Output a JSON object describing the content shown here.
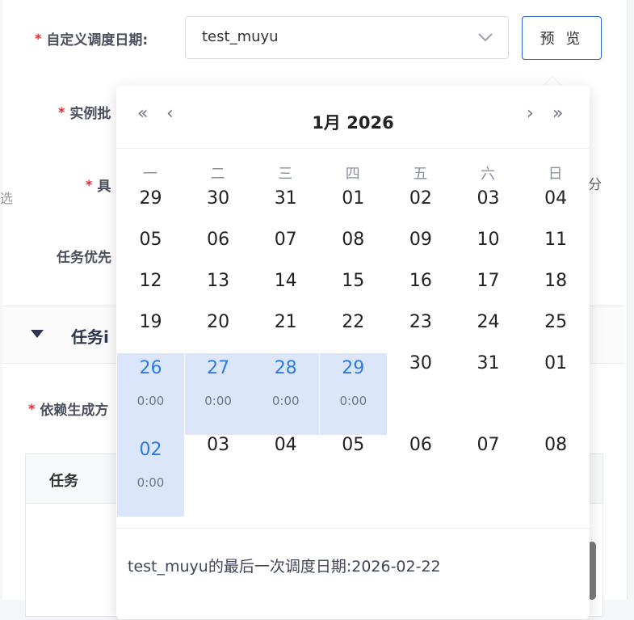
{
  "form": {
    "schedule_date_label": "自定义调度日期:",
    "instance_label": "实例批",
    "specific_label": "具",
    "priority_label": "任务优先",
    "dependency_label": "依赖生成方",
    "select_value": "test_muyu",
    "preview_label": "预 览"
  },
  "section": {
    "title": "任务i"
  },
  "table": {
    "col_task": "任务"
  },
  "edge": {
    "left_mark": "选",
    "right_mark": "分"
  },
  "calendar": {
    "title": "1月 2026",
    "weekdays": [
      "一",
      "二",
      "三",
      "四",
      "五",
      "六",
      "日"
    ],
    "days": [
      {
        "num": "29",
        "time": ""
      },
      {
        "num": "30",
        "time": ""
      },
      {
        "num": "31",
        "time": ""
      },
      {
        "num": "01",
        "time": ""
      },
      {
        "num": "02",
        "time": ""
      },
      {
        "num": "03",
        "time": ""
      },
      {
        "num": "04",
        "time": ""
      },
      {
        "num": "05",
        "time": ""
      },
      {
        "num": "06",
        "time": ""
      },
      {
        "num": "07",
        "time": ""
      },
      {
        "num": "08",
        "time": ""
      },
      {
        "num": "09",
        "time": ""
      },
      {
        "num": "10",
        "time": ""
      },
      {
        "num": "11",
        "time": ""
      },
      {
        "num": "12",
        "time": ""
      },
      {
        "num": "13",
        "time": ""
      },
      {
        "num": "14",
        "time": ""
      },
      {
        "num": "15",
        "time": ""
      },
      {
        "num": "16",
        "time": ""
      },
      {
        "num": "17",
        "time": ""
      },
      {
        "num": "18",
        "time": ""
      },
      {
        "num": "19",
        "time": ""
      },
      {
        "num": "20",
        "time": ""
      },
      {
        "num": "21",
        "time": ""
      },
      {
        "num": "22",
        "time": ""
      },
      {
        "num": "23",
        "time": ""
      },
      {
        "num": "24",
        "time": ""
      },
      {
        "num": "25",
        "time": ""
      },
      {
        "num": "26",
        "time": "0:00",
        "selected": true
      },
      {
        "num": "27",
        "time": "0:00",
        "selected": true
      },
      {
        "num": "28",
        "time": "0:00",
        "selected": true
      },
      {
        "num": "29",
        "time": "0:00",
        "selected": true
      },
      {
        "num": "30",
        "time": ""
      },
      {
        "num": "31",
        "time": ""
      },
      {
        "num": "01",
        "time": ""
      },
      {
        "num": "02",
        "time": "0:00",
        "selected": true
      },
      {
        "num": "03",
        "time": ""
      },
      {
        "num": "04",
        "time": ""
      },
      {
        "num": "05",
        "time": ""
      },
      {
        "num": "06",
        "time": ""
      },
      {
        "num": "07",
        "time": ""
      },
      {
        "num": "08",
        "time": ""
      }
    ],
    "footer": "test_muyu的最后一次调度日期:2026-02-22"
  },
  "colors": {
    "accent": "#2c7be5",
    "selected_bg": "#dbe6fb",
    "required": "#f5222d"
  }
}
